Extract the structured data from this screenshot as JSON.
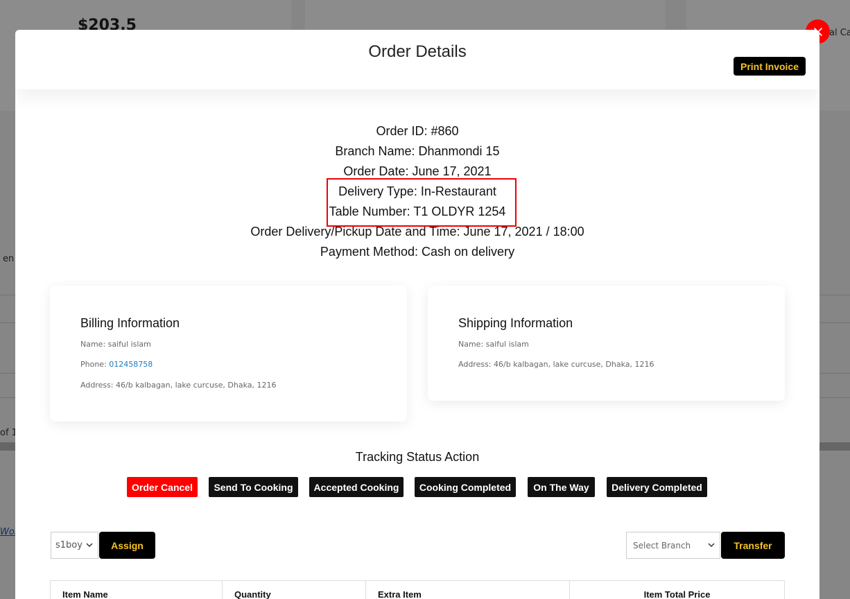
{
  "background": {
    "amount": "$203.5",
    "right_label": "al Car",
    "left_text_1": "en",
    "left_text_2": "of 1",
    "left_link": "Wor"
  },
  "modal": {
    "title": "Order Details",
    "print_label": "Print Invoice",
    "close_icon": "close-icon"
  },
  "order": {
    "id": "Order ID: #860",
    "branch": "Branch Name: Dhanmondi 15",
    "date": "Order Date: June 17, 2021",
    "delivery_type": "Delivery Type: In-Restaurant",
    "table_number": "Table Number: T1 OLDYR 1254",
    "delivery_time": "Order Delivery/Pickup Date and Time: June 17, 2021 / 18:00",
    "payment": "Payment Method: Cash on delivery"
  },
  "billing": {
    "title": "Billing Information",
    "name": "Name: saiful islam",
    "phone_label": "Phone: ",
    "phone": "012458758",
    "address": "Address: 46/b kalbagan, lake curcuse, Dhaka, 1216"
  },
  "shipping": {
    "title": "Shipping Information",
    "name": "Name: saiful islam",
    "address": "Address: 46/b kalbagan, lake curcuse, Dhaka, 1216"
  },
  "tracking": {
    "title": "Tracking Status Action",
    "buttons": [
      "Order Cancel",
      "Send To Cooking",
      "Accepted Cooking",
      "Cooking Completed",
      "On The Way",
      "Delivery Completed"
    ]
  },
  "assign": {
    "rider_value": "s1boy",
    "assign_label": "Assign",
    "branch_placeholder": "Select Branch",
    "transfer_label": "Transfer"
  },
  "table": {
    "headers": [
      "Item Name",
      "Quantity",
      "Extra Item",
      "Item Total Price"
    ]
  },
  "colors": {
    "accent_yellow": "#f4c327",
    "danger_red": "#ff0000",
    "highlight_red": "#e00000"
  }
}
